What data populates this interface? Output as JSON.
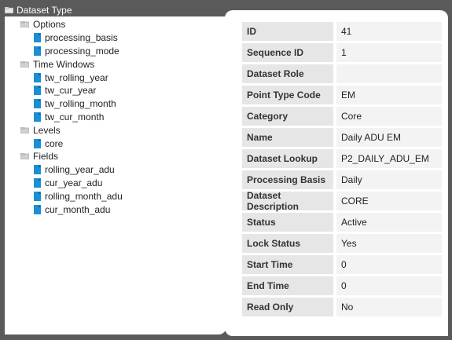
{
  "tree": {
    "root_label": "Dataset Type",
    "groups": [
      {
        "label": "Options",
        "items": [
          "processing_basis",
          "processing_mode"
        ]
      },
      {
        "label": "Time Windows",
        "items": [
          "tw_rolling_year",
          "tw_cur_year",
          "tw_rolling_month",
          "tw_cur_month"
        ]
      },
      {
        "label": "Levels",
        "items": [
          "core"
        ]
      },
      {
        "label": "Fields",
        "items": [
          "rolling_year_adu",
          "cur_year_adu",
          "rolling_month_adu",
          "cur_month_adu"
        ]
      }
    ]
  },
  "details": [
    {
      "label": "ID",
      "value": "41"
    },
    {
      "label": "Sequence ID",
      "value": "1"
    },
    {
      "label": "Dataset Role",
      "value": ""
    },
    {
      "label": "Point Type Code",
      "value": "EM"
    },
    {
      "label": "Category",
      "value": "Core"
    },
    {
      "label": "Name",
      "value": "Daily ADU EM"
    },
    {
      "label": "Dataset Lookup",
      "value": "P2_DAILY_ADU_EM"
    },
    {
      "label": "Processing Basis",
      "value": "Daily"
    },
    {
      "label": "Dataset Description",
      "value": "CORE"
    },
    {
      "label": "Status",
      "value": "Active"
    },
    {
      "label": "Lock Status",
      "value": "Yes"
    },
    {
      "label": "Start Time",
      "value": "0"
    },
    {
      "label": "End Time",
      "value": "0"
    },
    {
      "label": "Read Only",
      "value": "No"
    }
  ],
  "icons": {
    "root": "folder-icon",
    "group": "folder-icon",
    "item": "document-icon"
  },
  "colors": {
    "background": "#5a5a5a",
    "doc_icon": "#1a8fd6",
    "folder_icon": "#b8b8b8"
  }
}
